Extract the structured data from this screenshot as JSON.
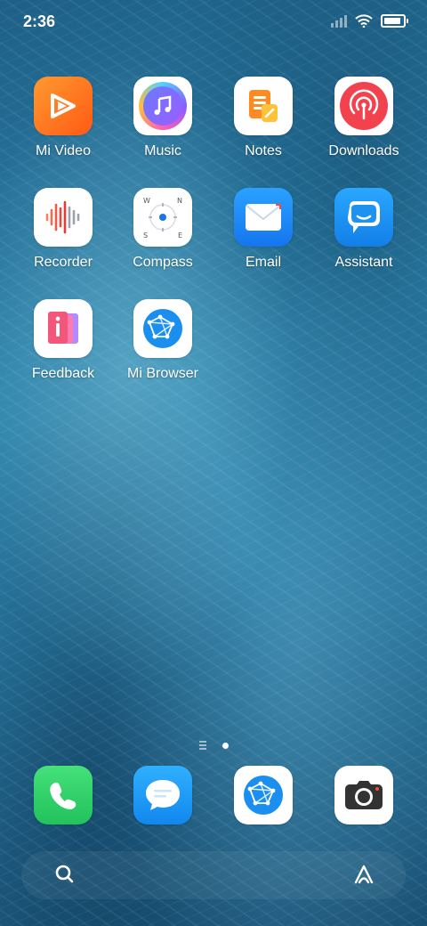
{
  "status_bar": {
    "time": "2:36",
    "icons": [
      "signal-icon",
      "wifi-icon",
      "battery-icon"
    ]
  },
  "apps": [
    {
      "label": "Mi Video",
      "icon": "play-icon",
      "color": "#ff7a1a"
    },
    {
      "label": "Music",
      "icon": "music-note-icon",
      "color": "#8a5cff"
    },
    {
      "label": "Notes",
      "icon": "notes-icon",
      "color": "#ff9b2f"
    },
    {
      "label": "Downloads",
      "icon": "broadcast-icon",
      "color": "#f2424e"
    },
    {
      "label": "Recorder",
      "icon": "waveform-icon",
      "color": "#f04e3e"
    },
    {
      "label": "Compass",
      "icon": "compass-icon",
      "color": "#e84a3a"
    },
    {
      "label": "Email",
      "icon": "envelope-icon",
      "color": "#1c8cf5"
    },
    {
      "label": "Assistant",
      "icon": "chat-bubble-icon",
      "color": "#1e92f0"
    },
    {
      "label": "Feedback",
      "icon": "info-icon",
      "color": "#f4567a"
    },
    {
      "label": "Mi Browser",
      "icon": "globe-icon",
      "color": "#1a8ff0"
    }
  ],
  "dock": [
    {
      "name": "phone",
      "icon": "phone-icon",
      "color": "#2fd06a"
    },
    {
      "name": "messaging",
      "icon": "message-icon",
      "color": "#1d9cf5"
    },
    {
      "name": "browser",
      "icon": "globe-icon",
      "color": "#1a8ff0"
    },
    {
      "name": "camera",
      "icon": "camera-icon",
      "color": "#333333"
    }
  ],
  "page_indicator": {
    "pages": 2,
    "current": 2
  },
  "search_bar": {
    "left_icon": "search-icon",
    "right_icon": "assistant-icon"
  }
}
